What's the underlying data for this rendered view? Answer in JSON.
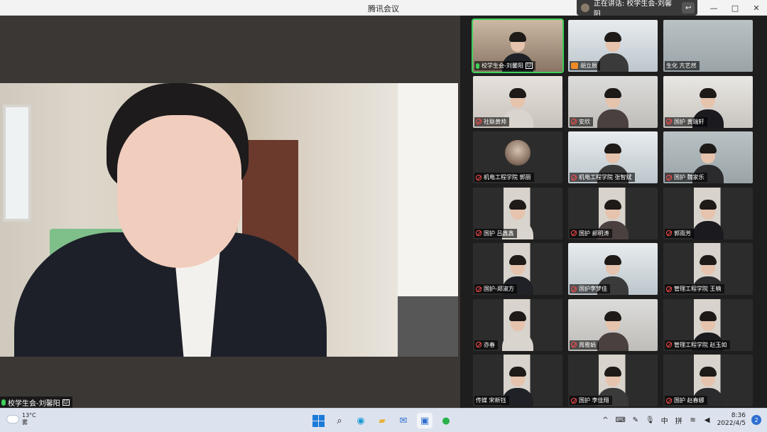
{
  "window": {
    "title": "腾讯会议",
    "minimize_label": "—",
    "maximize_label": "□",
    "close_label": "✕"
  },
  "speaking_banner": {
    "text": "正在讲话: 校学生会-刘馨阳",
    "return_icon": "return-arrow-icon"
  },
  "main_video": {
    "name": "校学生会-刘馨阳"
  },
  "gallery": {
    "tiles": [
      {
        "label": "校学生会-刘馨阳",
        "icon": "mic-on",
        "active": true
      },
      {
        "label": "胡立辰",
        "icon": "host"
      },
      {
        "label": "生化  亢艺然",
        "icon": "none"
      },
      {
        "label": "社联黄帅",
        "icon": "mic-off"
      },
      {
        "label": "安欣",
        "icon": "mic-off"
      },
      {
        "label": "国护  黄瑞轩",
        "icon": "mic-off"
      },
      {
        "label": "机电工程学院  郭丽",
        "icon": "mic-off",
        "avatar": true
      },
      {
        "label": "机电工程学院 张智斌",
        "icon": "mic-off"
      },
      {
        "label": "国护 魏家乐",
        "icon": "mic-off"
      },
      {
        "label": "国护  吕鑫鑫",
        "icon": "mic-off"
      },
      {
        "label": "国护  郝明涛",
        "icon": "mic-off"
      },
      {
        "label": "郭雨芳",
        "icon": "mic-off"
      },
      {
        "label": "国护-郑淑方",
        "icon": "mic-off"
      },
      {
        "label": "国护李梦佳",
        "icon": "mic-off"
      },
      {
        "label": "管理工程学院  王楠",
        "icon": "mic-off"
      },
      {
        "label": "亦春",
        "icon": "mic-off"
      },
      {
        "label": "周雅娟",
        "icon": "mic-off"
      },
      {
        "label": "管理工程学院  赵玉如",
        "icon": "mic-off"
      },
      {
        "label": "传媒 宋新钰",
        "icon": "none"
      },
      {
        "label": "国护  李佳翔",
        "icon": "mic-off"
      },
      {
        "label": "国护  赵春娜",
        "icon": "mic-off"
      }
    ]
  },
  "taskbar": {
    "weather_temp": "13°C",
    "weather_desc": "雾",
    "apps": [
      "windows-start-icon",
      "search-icon",
      "edge-browser-icon",
      "file-explorer-icon",
      "mail-icon",
      "tencent-meeting-icon",
      "wechat-icon"
    ],
    "tray": {
      "chevron": "^",
      "ime_mode": "中",
      "ime_pinyin": "拼",
      "time": "8:36",
      "date": "2022/4/5",
      "notifications": "2"
    }
  }
}
